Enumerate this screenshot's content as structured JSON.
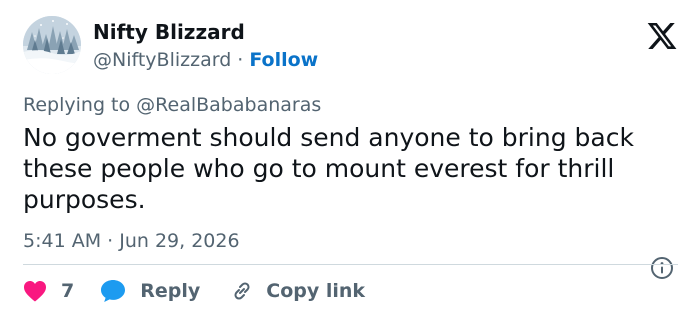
{
  "author": {
    "display_name": "Nifty Blizzard",
    "handle": "@NiftyBlizzard",
    "separator": "·",
    "follow_label": "Follow"
  },
  "reply_context": {
    "prefix": "Replying to",
    "to_handle": "@RealBababanaras"
  },
  "tweet": {
    "text": "No goverment should send anyone to bring back these people who go to mount everest for thrill purposes.",
    "timestamp": "5:41 AM · Jun 29, 2026"
  },
  "actions": {
    "like_count": "7",
    "reply_label": "Reply",
    "copy_label": "Copy link"
  },
  "colors": {
    "accent": "#0a73c9",
    "like": "#f91880",
    "reply": "#1d9bf0",
    "muted_text": "#536471",
    "divider": "#cfd9de"
  },
  "icons": {
    "brand": "x-logo-icon",
    "info": "info-icon",
    "like": "heart-icon",
    "reply": "speech-bubble-icon",
    "copy": "link-icon"
  }
}
